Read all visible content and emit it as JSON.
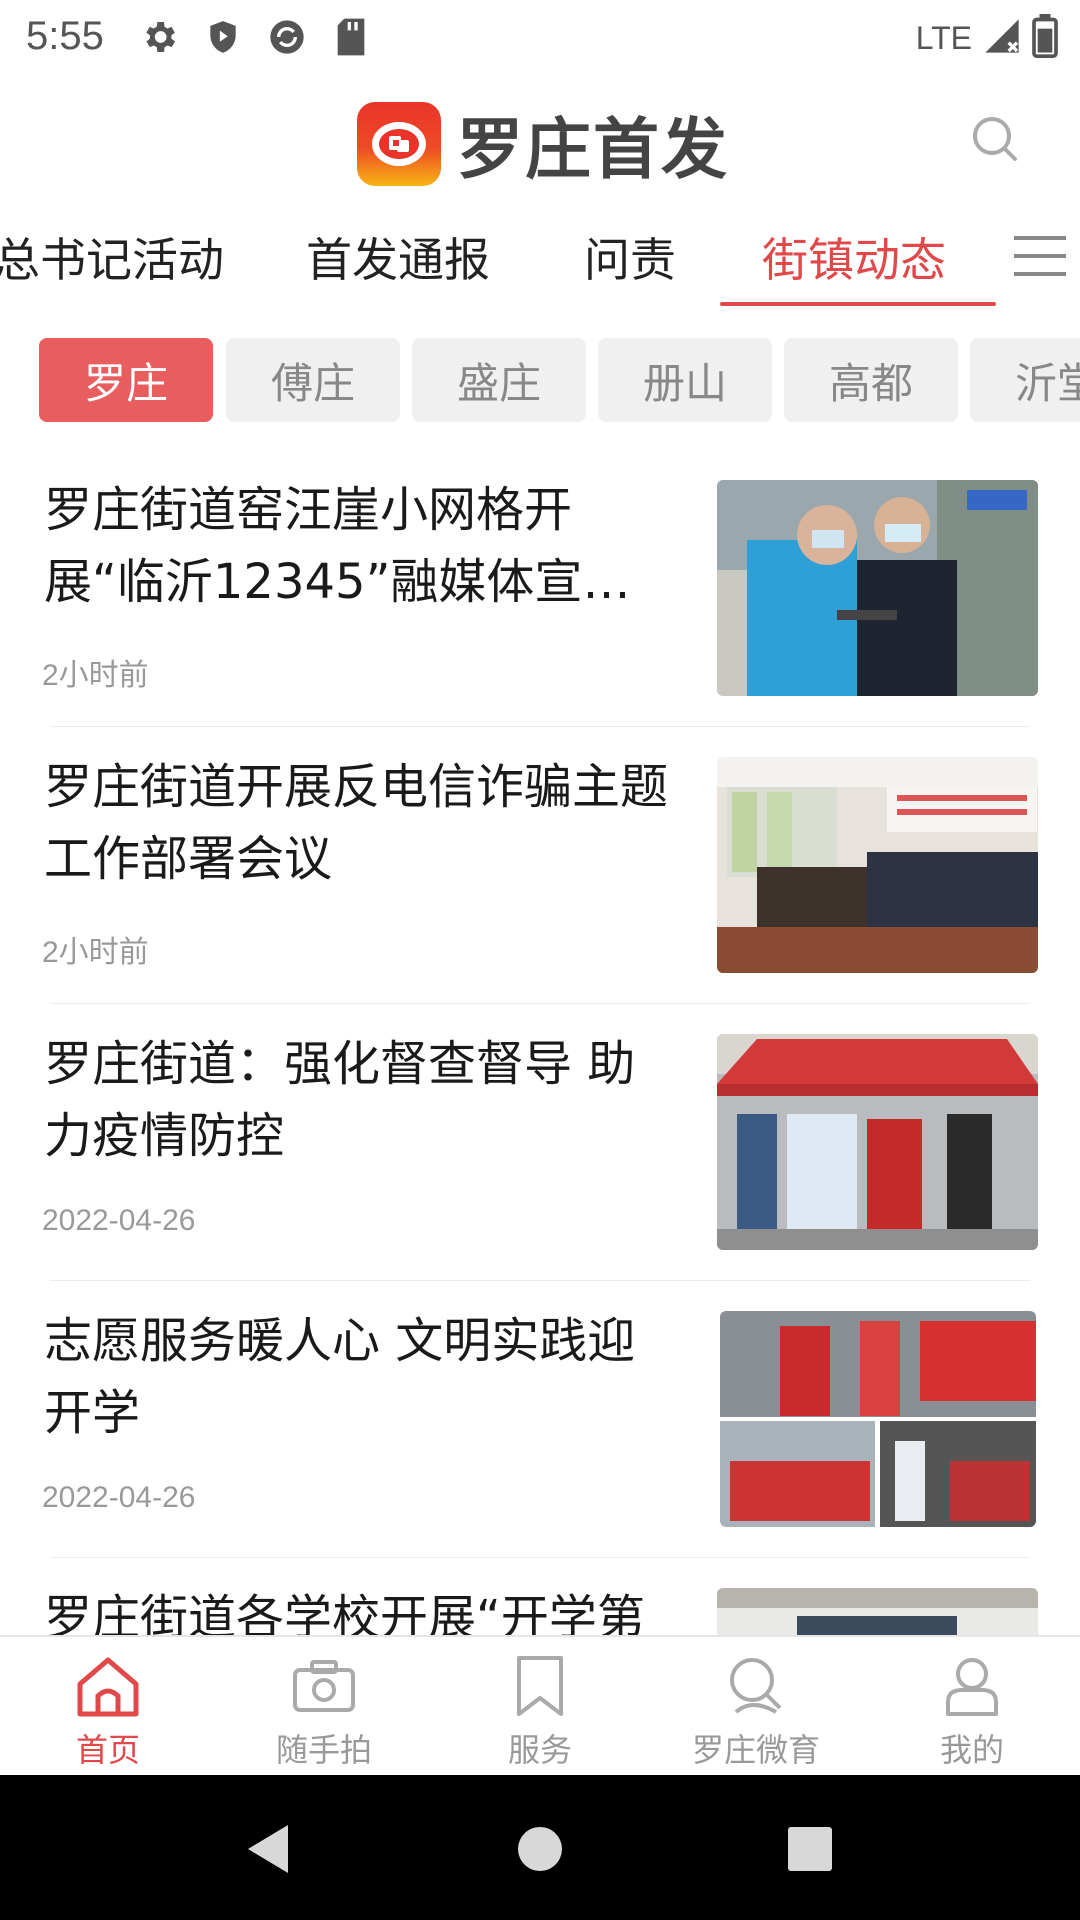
{
  "status_bar": {
    "time": "5:55",
    "network": "LTE",
    "icons": [
      "settings-gear-icon",
      "shield-play-icon",
      "sync-circle-icon",
      "sd-card-icon"
    ],
    "right_icons": [
      "signal-icon",
      "battery-icon"
    ]
  },
  "header": {
    "app_name": "罗庄首发",
    "logo_icon": "app-logo-icon",
    "search_icon": "search-icon"
  },
  "colors": {
    "accent": "#e0484a",
    "chip_active_bg": "#e85d5e",
    "chip_bg": "#f0f0f0",
    "logo_gradient": [
      "#e8342a",
      "#f7b515"
    ]
  },
  "category_tabs": [
    {
      "label": "总书记活动",
      "active": false
    },
    {
      "label": "首发通报",
      "active": false
    },
    {
      "label": "问责",
      "active": false
    },
    {
      "label": "街镇动态",
      "active": true
    }
  ],
  "category_more_icon": "menu-expand-icon",
  "town_chips": [
    {
      "label": "罗庄",
      "active": true
    },
    {
      "label": "傅庄",
      "active": false
    },
    {
      "label": "盛庄",
      "active": false
    },
    {
      "label": "册山",
      "active": false
    },
    {
      "label": "高都",
      "active": false
    },
    {
      "label": "沂堂",
      "active": false
    }
  ],
  "news": [
    {
      "title": "罗庄街道窑汪崖小网格开展“临沂12345”融媒体宣传…",
      "time": "2小时前",
      "thumb": "volunteers-in-blue-vests"
    },
    {
      "title": "罗庄街道开展反电信诈骗主题 工作部署会议",
      "time": "2小时前",
      "thumb": "meeting-room"
    },
    {
      "title": "罗庄街道：强化督查督导 助力疫情防控",
      "time": "2022-04-26",
      "thumb": "red-tent-checkpoint"
    },
    {
      "title": "志愿服务暖人心 文明实践迎开学",
      "time": "2022-04-26",
      "thumb": "volunteers-at-school"
    },
    {
      "title": "罗庄街道各学校开展“开学第",
      "time": "",
      "thumb": "classroom"
    }
  ],
  "bottom_nav": [
    {
      "label": "首页",
      "icon": "home-icon",
      "active": true
    },
    {
      "label": "随手拍",
      "icon": "camera-icon",
      "active": false
    },
    {
      "label": "服务",
      "icon": "bookmark-icon",
      "active": false
    },
    {
      "label": "罗庄微育",
      "icon": "education-search-icon",
      "active": false
    },
    {
      "label": "我的",
      "icon": "user-icon",
      "active": false
    }
  ]
}
